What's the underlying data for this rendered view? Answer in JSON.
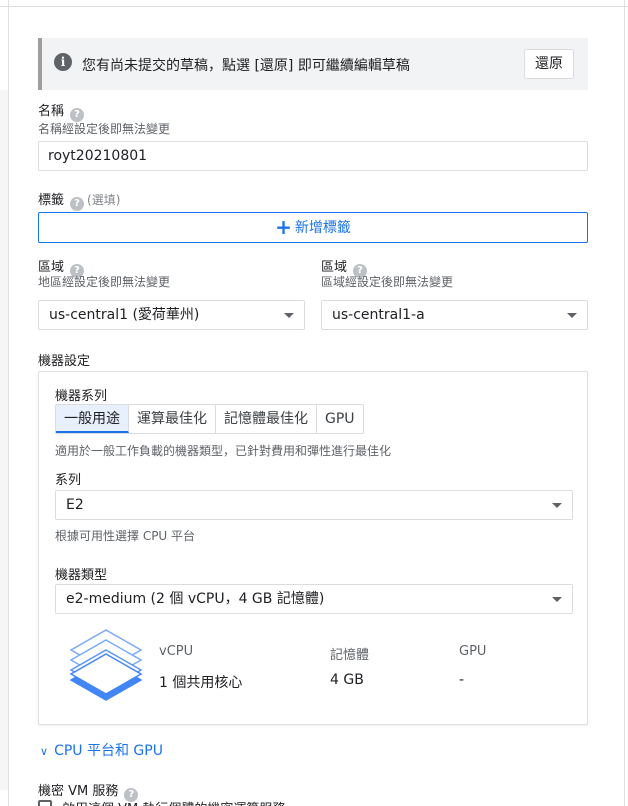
{
  "banner": {
    "message": "您有尚未提交的草稿，點選 [還原] 即可繼續編輯草稿",
    "restore_label": "還原"
  },
  "name": {
    "label": "名稱",
    "hint": "名稱經設定後即無法變更",
    "value": "royt20210801"
  },
  "labels": {
    "label": "標籤",
    "optional": "(選填)",
    "add_label": "新增標籤"
  },
  "region": {
    "label": "區域",
    "hint": "地區經設定後即無法變更",
    "value": "us-central1 (愛荷華州)"
  },
  "zone": {
    "label": "區域",
    "hint": "區域經設定後即無法變更",
    "value": "us-central1-a"
  },
  "machine_config": {
    "heading": "機器設定",
    "family_label": "機器系列",
    "tabs": [
      {
        "label": "一般用途",
        "active": true
      },
      {
        "label": "運算最佳化",
        "active": false
      },
      {
        "label": "記憶體最佳化",
        "active": false
      },
      {
        "label": "GPU",
        "active": false
      }
    ],
    "family_description": "適用於一般工作負載的機器類型，已針對費用和彈性進行最佳化",
    "series_label": "系列",
    "series_value": "E2",
    "series_hint": "根據可用性選擇 CPU 平台",
    "type_label": "機器類型",
    "type_value": "e2-medium (2 個 vCPU，4 GB 記憶體)",
    "specs": {
      "vcpu_header": "vCPU",
      "vcpu_value": "1 個共用核心",
      "memory_header": "記憶體",
      "memory_value": "4 GB",
      "gpu_header": "GPU",
      "gpu_value": "-"
    }
  },
  "cpu_platform_expander": "CPU 平台和 GPU",
  "confidential_vm": {
    "label": "機密 VM 服務",
    "checkbox_text": "啟用這個 VM 執行個體的機密運算服務"
  },
  "colors": {
    "accent": "#1a73e8",
    "text": "#202124",
    "muted": "#5f6368",
    "border": "#dadce0"
  }
}
